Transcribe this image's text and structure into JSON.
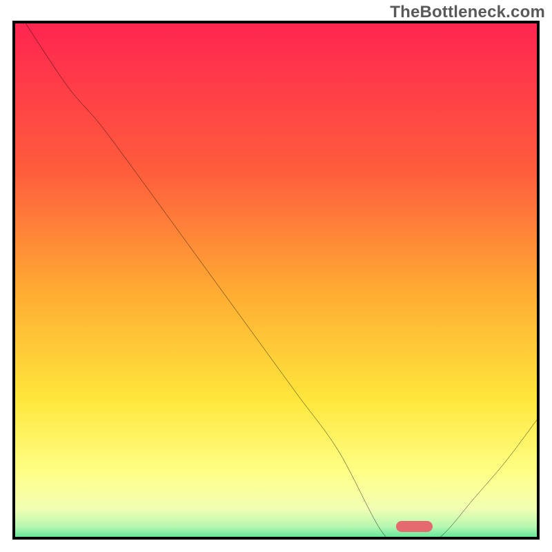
{
  "watermark": "TheBottleneck.com",
  "chart_data": {
    "type": "line",
    "title": "",
    "xlabel": "",
    "ylabel": "",
    "xlim": [
      0,
      100
    ],
    "ylim": [
      0,
      100
    ],
    "grid": false,
    "notes": "Axes are unlabeled. Bottleneck-style curve: value drops from ~100 at x≈2, has a soft shoulder around x≈22 at y≈73, falls near-linearly to a flat minimum (y≈0) over x≈70–80, then rises to y≈24 at x=100. A short rounded red bar marks the minimum at ≈(73–80, 2).",
    "series": [
      {
        "name": "bottleneck-curve",
        "color": "#000000",
        "x": [
          2,
          10,
          16,
          22,
          30,
          38,
          46,
          54,
          62,
          70,
          74,
          78,
          82,
          88,
          94,
          100
        ],
        "values": [
          100,
          88,
          81,
          73,
          62,
          51,
          40,
          29,
          18,
          3,
          0,
          0,
          2,
          9,
          16,
          24
        ]
      }
    ],
    "marker": {
      "x_start": 73,
      "x_end": 80,
      "y": 2,
      "color": "#e46a6f",
      "shape": "rounded-bar"
    },
    "background_gradient": {
      "stops": [
        {
          "pos": 0.0,
          "color": "#ff2550"
        },
        {
          "pos": 0.28,
          "color": "#ff5c3c"
        },
        {
          "pos": 0.52,
          "color": "#ffad33"
        },
        {
          "pos": 0.72,
          "color": "#ffe63b"
        },
        {
          "pos": 0.86,
          "color": "#ffff86"
        },
        {
          "pos": 0.93,
          "color": "#f2ffb3"
        },
        {
          "pos": 0.965,
          "color": "#b5f7b0"
        },
        {
          "pos": 1.0,
          "color": "#27d88b"
        }
      ]
    }
  }
}
